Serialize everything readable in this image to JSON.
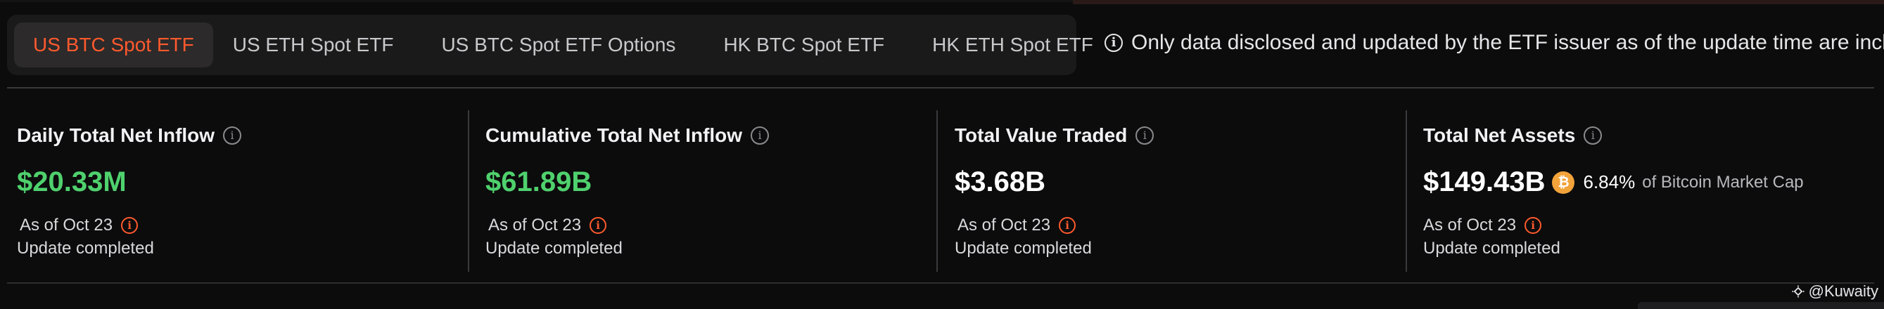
{
  "tabs": [
    {
      "label": "US BTC Spot ETF",
      "active": true
    },
    {
      "label": "US ETH Spot ETF",
      "active": false
    },
    {
      "label": "US BTC Spot ETF Options",
      "active": false
    },
    {
      "label": "HK BTC Spot ETF",
      "active": false
    },
    {
      "label": "HK ETH Spot ETF",
      "active": false
    }
  ],
  "notice": {
    "icon": "info-icon",
    "text": "Only data disclosed and updated by the ETF issuer as of the update time are included."
  },
  "cards": [
    {
      "title": "Daily Total Net Inflow",
      "value": "$20.33M",
      "value_color": "#4fd16d",
      "as_of": "As of Oct 23",
      "status": "Update completed"
    },
    {
      "title": "Cumulative Total Net Inflow",
      "value": "$61.89B",
      "value_color": "#4fd16d",
      "as_of": "As of Oct 23",
      "status": "Update completed"
    },
    {
      "title": "Total Value Traded",
      "value": "$3.68B",
      "value_color": "#ffffff",
      "as_of": "As of Oct 23",
      "status": "Update completed"
    },
    {
      "title": "Total Net Assets",
      "value": "$149.43B",
      "value_color": "#ffffff",
      "btc_icon": "bitcoin-icon",
      "market_cap_pct": "6.84%",
      "market_cap_label": "of Bitcoin Market Cap",
      "as_of": "As of Oct 23",
      "status": "Update completed"
    }
  ],
  "watermark": {
    "handle": "@Kuwaity"
  },
  "colors": {
    "accent": "#ff5a2e",
    "positive": "#4fd16d",
    "bitcoin": "#f2a33a",
    "background": "#0c0c0d",
    "tabbar_bg": "#1a1a1b"
  }
}
